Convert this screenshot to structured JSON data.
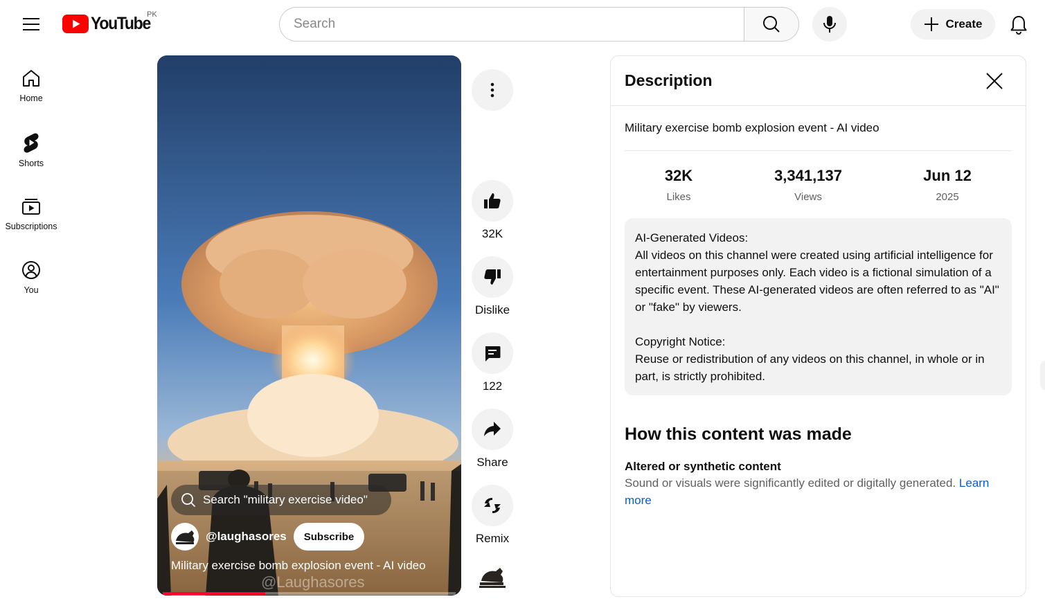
{
  "header": {
    "logo_text": "YouTube",
    "region": "PK",
    "search_placeholder": "Search",
    "create_label": "Create"
  },
  "nav": [
    {
      "label": "Home",
      "icon": "home-icon"
    },
    {
      "label": "Shorts",
      "icon": "shorts-icon"
    },
    {
      "label": "Subscriptions",
      "icon": "subscriptions-icon"
    },
    {
      "label": "You",
      "icon": "you-icon"
    }
  ],
  "video": {
    "search_suggestion": "Search \"military exercise video\"",
    "channel_handle": "@laughasores",
    "subscribe_label": "Subscribe",
    "title": "Military exercise bomb explosion event - AI video",
    "watermark": "@Laughasores",
    "progress": 0.35
  },
  "actions": {
    "likes": "32K",
    "dislike": "Dislike",
    "comments": "122",
    "share": "Share",
    "remix": "Remix"
  },
  "description": {
    "heading": "Description",
    "title": "Military exercise bomb explosion event - AI video",
    "stats": [
      {
        "value": "32K",
        "label": "Likes"
      },
      {
        "value": "3,341,137",
        "label": "Views"
      },
      {
        "value": "Jun 12",
        "label": "2025"
      }
    ],
    "body": {
      "ai_heading": "AI-Generated Videos:",
      "ai_text": "All videos on this channel were created using artificial intelligence for entertainment purposes only. Each video is a fictional simulation of a specific event. These AI-generated videos are often referred to as \"AI\" or \"fake\" by viewers.",
      "copyright_heading": "Copyright Notice:",
      "copyright_text": "Reuse or redistribution of any videos on this channel, in whole or in part, is strictly prohibited."
    },
    "how_made_heading": "How this content was made",
    "altered_label": "Altered or synthetic content",
    "altered_text": "Sound or visuals were significantly edited or digitally generated.",
    "learn_more": "Learn more"
  },
  "colors": {
    "brand_red": "#ff0000",
    "link_blue": "#065fd4",
    "progress_red": "#ff0033"
  }
}
